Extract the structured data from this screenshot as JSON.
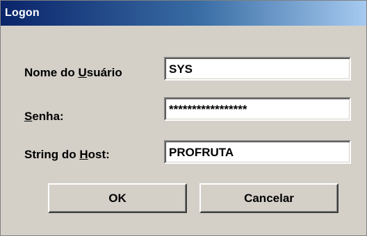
{
  "window": {
    "title": "Logon"
  },
  "form": {
    "username": {
      "label_pre": "Nome do ",
      "label_mnemonic": "U",
      "label_post": "suário",
      "value": "SYS"
    },
    "password": {
      "label_pre": "",
      "label_mnemonic": "S",
      "label_post": "enha:",
      "value": "*****************"
    },
    "host": {
      "label_pre": "String do ",
      "label_mnemonic": "H",
      "label_post": "ost:",
      "value": "PROFRUTA"
    }
  },
  "buttons": {
    "ok_label": "OK",
    "cancel_label": "Cancelar"
  },
  "colors": {
    "face": "#d4d0c8",
    "title_start": "#0a246a",
    "title_end": "#a6caf0"
  }
}
